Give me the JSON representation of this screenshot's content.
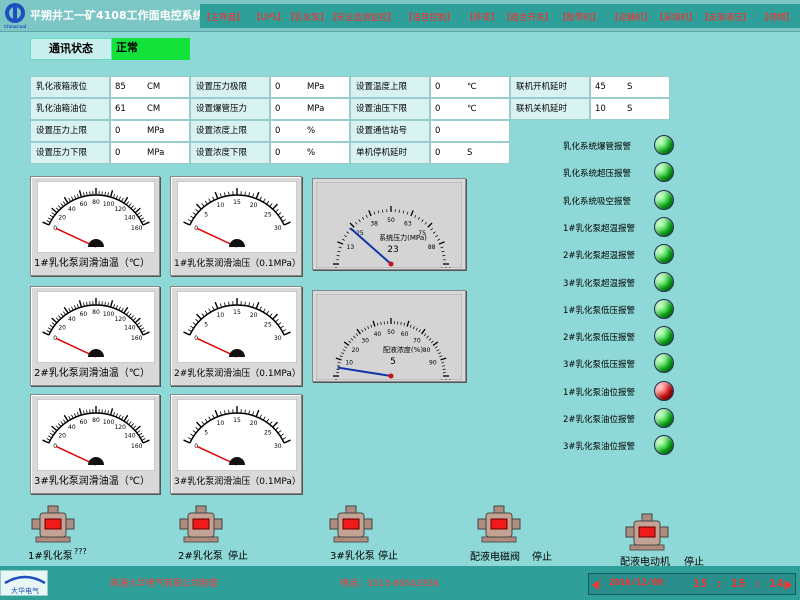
{
  "header": {
    "title": "平朔井工一矿4108工作面电控系统",
    "logo_text": "ChinaCoal",
    "nav": [
      "【主界面】",
      "【UPS】",
      "【乳化泵】",
      "【安全监测监控】",
      "【语音控制】",
      "【移变】",
      "【组合开关】",
      "【胶带机】",
      "【运输机】",
      "【采煤机】",
      "【支架液压】",
      "【视频】"
    ]
  },
  "comm": {
    "label": "通讯状态",
    "value": "正常"
  },
  "params": [
    {
      "label": "乳化液箱液位",
      "value": "85",
      "unit": "CM"
    },
    {
      "label": "设置压力极限",
      "value": "0",
      "unit": "MPa"
    },
    {
      "label": "设置温度上限",
      "value": "0",
      "unit": "℃"
    },
    {
      "label": "联机开机延时",
      "value": "45",
      "unit": "S"
    },
    {
      "label": "乳化油箱油位",
      "value": "61",
      "unit": "CM"
    },
    {
      "label": "设置爆管压力",
      "value": "0",
      "unit": "MPa"
    },
    {
      "label": "设置油压下限",
      "value": "0",
      "unit": "℃"
    },
    {
      "label": "联机关机延时",
      "value": "10",
      "unit": "S"
    },
    {
      "label": "设置压力上限",
      "value": "0",
      "unit": "MPa"
    },
    {
      "label": "设置浓度上限",
      "value": "0",
      "unit": "%"
    },
    {
      "label": "设置通信站号",
      "value": "0",
      "unit": ""
    },
    {
      "label": "设置压力下限",
      "value": "0",
      "unit": "MPa"
    },
    {
      "label": "设置浓度下限",
      "value": "0",
      "unit": "%"
    },
    {
      "label": "单机停机延时",
      "value": "0",
      "unit": "S"
    }
  ],
  "gauges": [
    {
      "label": "1#乳化泵润滑油温（℃）",
      "ticks": [
        "0",
        "20",
        "40",
        "60",
        "80",
        "100",
        "120",
        "140",
        "160"
      ],
      "max": 160,
      "value": 0
    },
    {
      "label": "1#乳化泵润滑油压（0.1MPa）",
      "ticks": [
        "0",
        "5",
        "10",
        "15",
        "20",
        "25",
        "30"
      ],
      "max": 30,
      "value": 0
    },
    {
      "label": "2#乳化泵润滑油温（℃）",
      "ticks": [
        "0",
        "20",
        "40",
        "60",
        "80",
        "100",
        "120",
        "140",
        "160"
      ],
      "max": 160,
      "value": 0
    },
    {
      "label": "2#乳化泵润滑油压（0.1MPa）",
      "ticks": [
        "0",
        "5",
        "10",
        "15",
        "20",
        "25",
        "30"
      ],
      "max": 30,
      "value": 0
    },
    {
      "label": "3#乳化泵润滑油温（℃）",
      "ticks": [
        "0",
        "20",
        "40",
        "60",
        "80",
        "100",
        "120",
        "140",
        "160"
      ],
      "max": 160,
      "value": 0
    },
    {
      "label": "3#乳化泵润滑油压（0.1MPa）",
      "ticks": [
        "0",
        "5",
        "10",
        "15",
        "20",
        "25",
        "30"
      ],
      "max": 30,
      "value": 0
    }
  ],
  "dials": [
    {
      "label": "系统压力(MPa)",
      "value_text": "23",
      "ticks": [
        "0",
        "13",
        "25",
        "38",
        "50",
        "63",
        "75",
        "88",
        "100"
      ],
      "max": 100,
      "value": 23
    },
    {
      "label": "配液浓度(%)",
      "value_text": "5",
      "ticks": [
        "0",
        "10",
        "20",
        "30",
        "40",
        "50",
        "60",
        "70",
        "80",
        "90",
        "100"
      ],
      "max": 100,
      "value": 5
    }
  ],
  "alarms": [
    {
      "label": "乳化系统爆管报警",
      "state": "green"
    },
    {
      "label": "乳化系统超压报警",
      "state": "green"
    },
    {
      "label": "乳化系统吸空报警",
      "state": "green"
    },
    {
      "label": "1#乳化泵超温报警",
      "state": "green"
    },
    {
      "label": "2#乳化泵超温报警",
      "state": "green"
    },
    {
      "label": "3#乳化泵超温报警",
      "state": "green"
    },
    {
      "label": "1#乳化泵低压报警",
      "state": "green"
    },
    {
      "label": "2#乳化泵低压报警",
      "state": "green"
    },
    {
      "label": "3#乳化泵低压报警",
      "state": "green"
    },
    {
      "label": "1#乳化泵油位报警",
      "state": "red"
    },
    {
      "label": "2#乳化泵油位报警",
      "state": "green"
    },
    {
      "label": "3#乳化泵油位报警",
      "state": "green"
    }
  ],
  "pumps": [
    {
      "name": "1#乳化泵",
      "status": "???"
    },
    {
      "name": "2#乳化泵",
      "status": "停止"
    },
    {
      "name": "3#乳化泵",
      "status": "停止"
    },
    {
      "name": "配液电磁阀",
      "status": "停止"
    },
    {
      "name": "配液电动机",
      "status": "停止"
    }
  ],
  "footer": {
    "logo_text": "大华电气",
    "company": "南通大华电气有限公司制造",
    "phone": "电话：0513-86542936",
    "date": "2010/12/09",
    "time": "15 : 15 : 14"
  },
  "colors": {
    "background": "#8ed9d7",
    "ok": "#12e23a",
    "alarm": "#e31010",
    "nav_text": "#ff2a2a"
  }
}
